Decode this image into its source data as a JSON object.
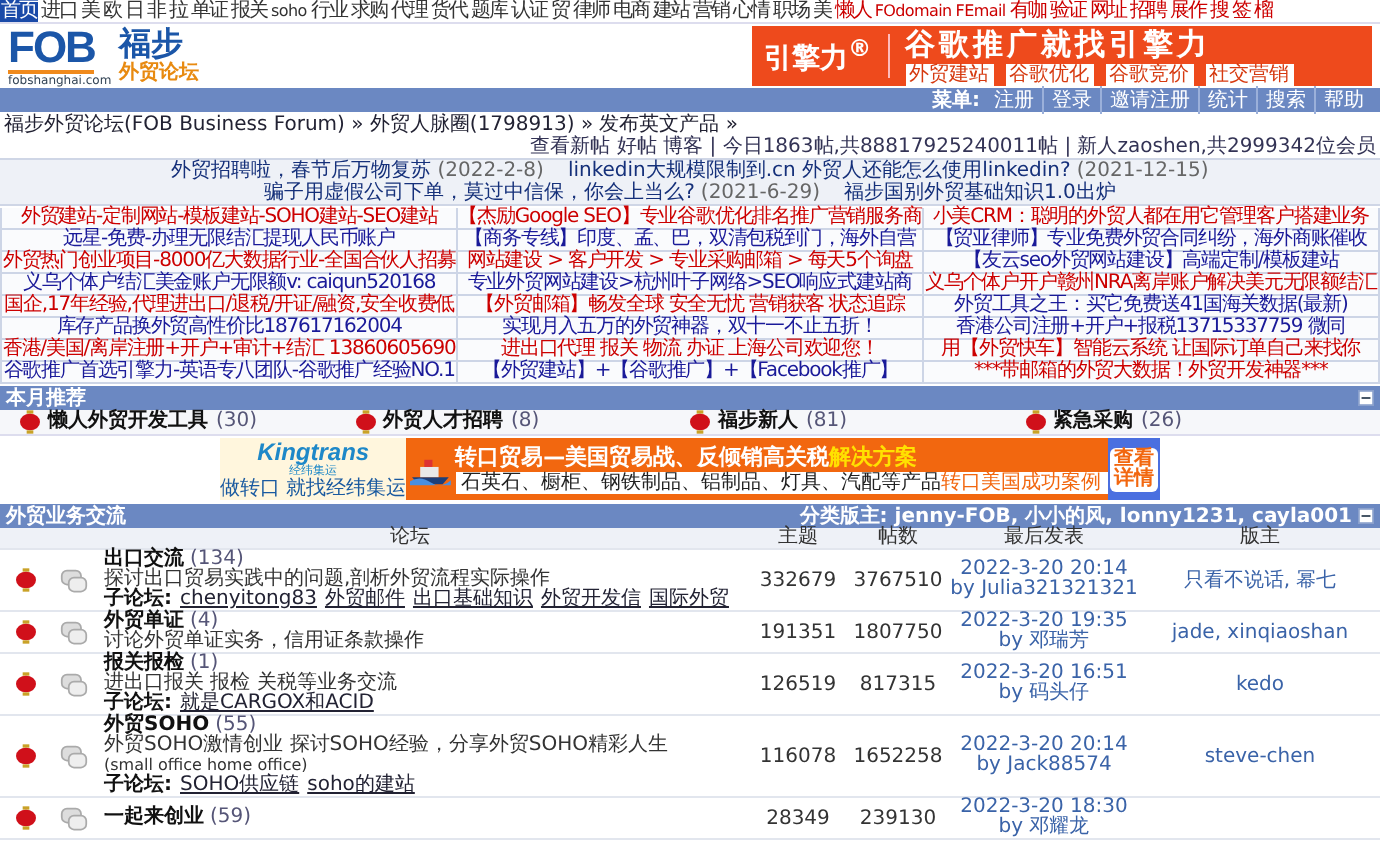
{
  "top_nav": [
    {
      "label": "首页",
      "color": "#1a4aa8",
      "selected": true
    },
    {
      "label": "进口",
      "color": "#333333",
      "selected": false
    },
    {
      "label": "美",
      "color": "#333333",
      "selected": false
    },
    {
      "label": "欧",
      "color": "#333333",
      "selected": false
    },
    {
      "label": "日",
      "color": "#333333",
      "selected": false
    },
    {
      "label": "非",
      "color": "#333333",
      "selected": false
    },
    {
      "label": "拉",
      "color": "#333333",
      "selected": false
    },
    {
      "label": "单证",
      "color": "#333333",
      "selected": false
    },
    {
      "label": "报关",
      "color": "#333333",
      "selected": false
    },
    {
      "label": "soho",
      "color": "#333333",
      "selected": false
    },
    {
      "label": "行业",
      "color": "#333333",
      "selected": false
    },
    {
      "label": "求购",
      "color": "#333333",
      "selected": false
    },
    {
      "label": "代理",
      "color": "#333333",
      "selected": false
    },
    {
      "label": "货代",
      "color": "#333333",
      "selected": false
    },
    {
      "label": "题库",
      "color": "#333333",
      "selected": false
    },
    {
      "label": "认证",
      "color": "#333333",
      "selected": false
    },
    {
      "label": "贸",
      "color": "#333333",
      "selected": false
    },
    {
      "label": "律师",
      "color": "#333333",
      "selected": false
    },
    {
      "label": "电商",
      "color": "#333333",
      "selected": false
    },
    {
      "label": "建站",
      "color": "#333333",
      "selected": false
    },
    {
      "label": "营销",
      "color": "#333333",
      "selected": false
    },
    {
      "label": "心情",
      "color": "#333333",
      "selected": false
    },
    {
      "label": "职场",
      "color": "#333333",
      "selected": false
    },
    {
      "label": "美",
      "color": "#333333",
      "selected": false
    },
    {
      "label": "懒人",
      "color": "#cc0000",
      "selected": false
    },
    {
      "label": "FOdomain",
      "color": "#cc0000",
      "selected": false
    },
    {
      "label": "FEmail",
      "color": "#cc0000",
      "selected": false
    },
    {
      "label": "有咖",
      "color": "#cc0000",
      "selected": false
    },
    {
      "label": "验证",
      "color": "#cc0000",
      "selected": false
    },
    {
      "label": "网址",
      "color": "#cc0000",
      "selected": false
    },
    {
      "label": "招聘",
      "color": "#cc0000",
      "selected": false
    },
    {
      "label": "展作",
      "color": "#cc0000",
      "selected": false
    },
    {
      "label": "搜",
      "color": "#cc0000",
      "selected": false
    },
    {
      "label": "签",
      "color": "#cc0000",
      "selected": false
    },
    {
      "label": "榴",
      "color": "#cc0000",
      "selected": false
    }
  ],
  "logo": {
    "mark": "FOB",
    "domain": "fobshanghai.com",
    "name": "福步",
    "subtitle": "外贸论坛"
  },
  "header_ad": {
    "brand": "引擎力$^{®}$",
    "headline": "谷歌推广就找引擎力",
    "tags": [
      "外贸建站",
      "谷歌优化",
      "谷歌竞价",
      "社交营销"
    ]
  },
  "menu": {
    "label": "菜单:",
    "links": [
      "注册",
      "登录",
      "邀请注册",
      "统计",
      "搜索",
      "帮助"
    ]
  },
  "breadcrumb": "福步外贸论坛(FOB Business Forum) » 外贸人脉圈(1798913) » 发布英文产品 »",
  "stats": "查看新帖 好帖 博客 | 今日1863帖,共88817925240011帖 | 新人zaoshen,共2999342位会员",
  "announcements": [
    {
      "text": "外贸招聘啦，春节后万物复苏",
      "date": "(2022-2-8)"
    },
    {
      "text": "linkedin大规模限制到.cn 外贸人还能怎么使用linkedin?",
      "date": "(2021-12-15)"
    },
    {
      "text": "骗子用虚假公司下单，莫过中信保，你会上当么?",
      "date": "(2021-6-29)"
    },
    {
      "text": "福步国别外贸基础知识1.0出炉"
    }
  ],
  "ad_links": [
    {
      "text": "外贸建站-定制网站-模板建站-SOHO建站-SEO建站",
      "color": "#cc0000"
    },
    {
      "text": "【杰励Google SEO】专业谷歌优化排名推广营销服务商",
      "color": "#cc0000"
    },
    {
      "text": "小美CRM：聪明的外贸人都在用它管理客户搭建业务",
      "color": "#cc0000"
    },
    {
      "text": "远星-免费-办理无限结汇提现人民币账户",
      "color": "#1a1a99"
    },
    {
      "text": "【商务专线】印度、孟、巴，双清包税到门，海外自营",
      "color": "#1a1a99"
    },
    {
      "text": "【贸亚律师】专业免费外贸合同纠纷，海外商账催收",
      "color": "#1a1a99"
    },
    {
      "text": "外贸热门创业项目-8000亿大数据行业-全国合伙人招募",
      "color": "#cc0000"
    },
    {
      "text": "网站建设 > 客户开发 > 专业采购邮箱 > 每天5个询盘",
      "color": "#cc0000"
    },
    {
      "text": "【友云seo外贸网站建设】高端定制/模板建站",
      "color": "#1a1a99"
    },
    {
      "text": "义乌个体户结汇美金账户无限额v: caiqun520168",
      "color": "#1a1a99"
    },
    {
      "text": "专业外贸网站建设>杭州叶子网络>SEO响应式建站商",
      "color": "#1a1a99"
    },
    {
      "text": "义乌个体户开户赣州NRA离岸账户解决美元无限额结汇",
      "color": "#cc0000"
    },
    {
      "text": "国企,17年经验,代理进出口/退税/开证/融资,安全收费低",
      "color": "#cc0000"
    },
    {
      "text": "【外贸邮箱】畅发全球 安全无忧 营销获客 状态追踪",
      "color": "#cc0000"
    },
    {
      "text": "外贸工具之王：买它免费送41国海关数据(最新)",
      "color": "#1a1a99"
    },
    {
      "text": "库存产品换外贸高性价比187617162004",
      "color": "#1a1a99"
    },
    {
      "text": "实现月入五万的外贸神器，双十一不止五折！",
      "color": "#1a1a99"
    },
    {
      "text": "香港公司注册+开户+报税13715337759 微同",
      "color": "#1a1a99"
    },
    {
      "text": "香港/美国/离岸注册+开户+审计+结汇 13860605690",
      "color": "#cc0000"
    },
    {
      "text": "进出口代理 报关 物流 办证 上海公司欢迎您！",
      "color": "#cc0000"
    },
    {
      "text": "用【外贸快车】智能云系统 让国际订单自己来找你",
      "color": "#cc0000"
    },
    {
      "text": "谷歌推广首选引擎力-英语专八团队-谷歌推广经验NO.1",
      "color": "#1a1a99"
    },
    {
      "text": "【外贸建站】+【谷歌推广】+【Facebook推广】",
      "color": "#1a1a99"
    },
    {
      "text": "***带邮箱的外贸大数据！外贸开发神器***",
      "color": "#cc0000"
    }
  ],
  "featured": {
    "title": "本月推荐",
    "items": [
      {
        "name": "懒人外贸开发工具",
        "count": "(30)"
      },
      {
        "name": "外贸人才招聘",
        "count": "(8)"
      },
      {
        "name": "福步新人",
        "count": "(81)"
      },
      {
        "name": "紧急采购",
        "count": "(26)"
      }
    ]
  },
  "banner_ad": {
    "brand": "Kingtrans",
    "brand_cn": "经纬集运",
    "slogan": "做转口 就找经纬集运",
    "headline": "转口贸易—美国贸易战、反倾销高关税",
    "headline_highlight": "解决方案",
    "products": "石英石、橱柜、钢铁制品、铝制品、灯具、汽配等产品",
    "products_highlight": "转口美国成功案例",
    "button": "查看详情"
  },
  "category": {
    "title": "外贸业务交流",
    "moderators": "分类版主: jenny-FOB, 小小的风, lonny1231, cayla001",
    "columns": [
      "论坛",
      "主题",
      "帖数",
      "最后发表",
      "版主"
    ],
    "forums": [
      {
        "name": "出口交流",
        "count": "(134)",
        "description": "探讨出口贸易实践中的问题,剖析外贸流程实际操作",
        "subforum_label": "子论坛:",
        "subforums": [
          "chenyitong83",
          "外贸邮件",
          "出口基础知识",
          "外贸开发信",
          "国际外贸"
        ],
        "topics": "332679",
        "posts": "3767510",
        "last_time": "2022-3-20 20:14",
        "last_by": "by Julia321321321",
        "moderators": "只看不说话, 幂七"
      },
      {
        "name": "外贸单证",
        "count": "(4)",
        "description": "讨论外贸单证实务，信用证条款操作",
        "topics": "191351",
        "posts": "1807750",
        "last_time": "2022-3-20 19:35",
        "last_by": "by 邓瑞芳",
        "moderators": "jade, xinqiaoshan"
      },
      {
        "name": "报关报检",
        "count": "(1)",
        "description": "进出口报关 报检 关税等业务交流",
        "subforum_label": "子论坛:",
        "subforums": [
          "就是CARGOX和ACID"
        ],
        "topics": "126519",
        "posts": "817315",
        "last_time": "2022-3-20 16:51",
        "last_by": "by 码头仔",
        "moderators": "kedo"
      },
      {
        "name": "外贸SOHO",
        "count": "(55)",
        "description": "外贸SOHO激情创业 探讨SOHO经验，分享外贸SOHO精彩人生",
        "description_2": "(small office home office)",
        "subforum_label": "子论坛:",
        "subforums": [
          "SOHO供应链",
          "soho的建站"
        ],
        "topics": "116078",
        "posts": "1652258",
        "last_time": "2022-3-20 20:14",
        "last_by": "by Jack88574",
        "moderators": "steve-chen"
      },
      {
        "name": "一起来创业",
        "count": "(59)",
        "topics": "28349",
        "posts": "239130",
        "last_time": "2022-3-20 18:30",
        "last_by": "by 邓耀龙"
      }
    ]
  }
}
